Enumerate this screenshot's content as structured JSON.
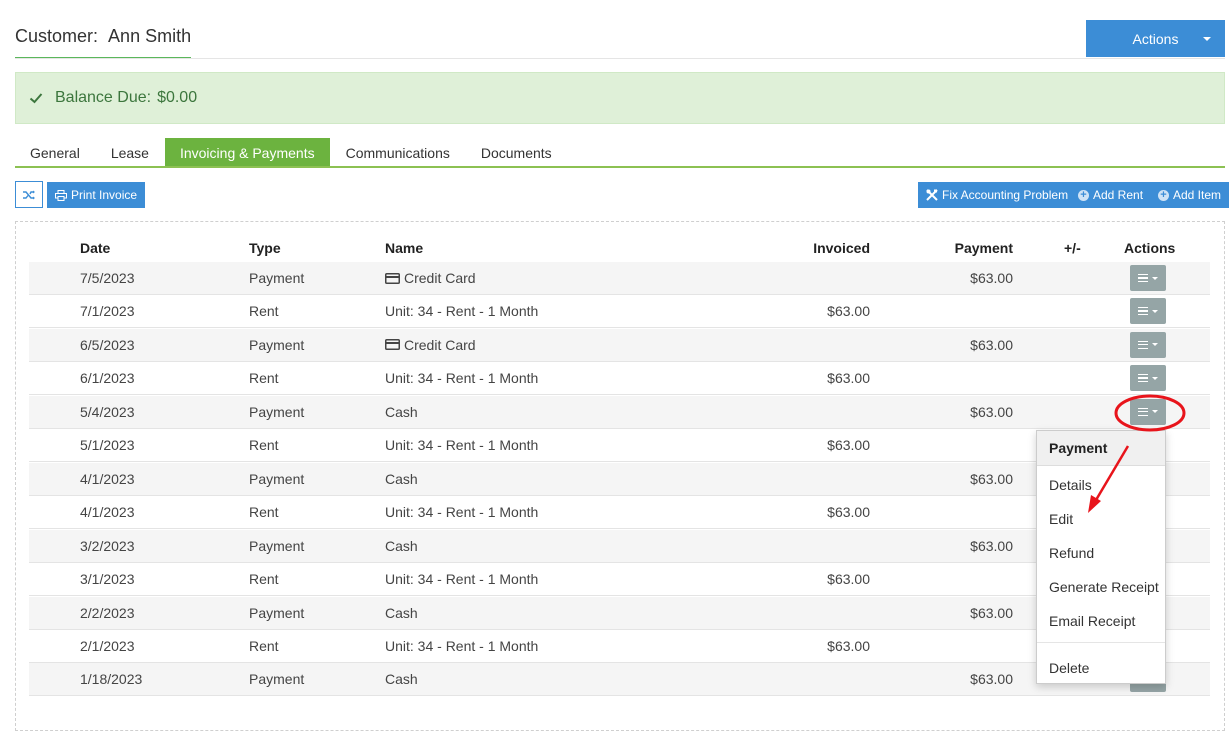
{
  "header": {
    "title_prefix": "Customer:",
    "customer_name": "Ann Smith",
    "actions_label": "Actions"
  },
  "balance": {
    "label": "Balance Due:",
    "amount": "$0.00"
  },
  "tabs": [
    {
      "label": "General"
    },
    {
      "label": "Lease"
    },
    {
      "label": "Invoicing & Payments",
      "active": true
    },
    {
      "label": "Communications"
    },
    {
      "label": "Documents"
    }
  ],
  "toolbar": {
    "print_invoice": "Print Invoice",
    "fix_accounting": "Fix Accounting Problem",
    "add_rent": "Add Rent",
    "add_item": "Add Item"
  },
  "table": {
    "headers": {
      "date": "Date",
      "type": "Type",
      "name": "Name",
      "invoiced": "Invoiced",
      "payment": "Payment",
      "plusminus": "+/-",
      "actions": "Actions"
    },
    "rows": [
      {
        "date": "7/5/2023",
        "type": "Payment",
        "name": "Credit Card",
        "card": true,
        "invoiced": "",
        "payment": "$63.00"
      },
      {
        "date": "7/1/2023",
        "type": "Rent",
        "name": "Unit: 34 - Rent - 1 Month",
        "invoiced": "$63.00",
        "payment": ""
      },
      {
        "date": "6/5/2023",
        "type": "Payment",
        "name": "Credit Card",
        "card": true,
        "invoiced": "",
        "payment": "$63.00"
      },
      {
        "date": "6/1/2023",
        "type": "Rent",
        "name": "Unit: 34 - Rent - 1 Month",
        "invoiced": "$63.00",
        "payment": ""
      },
      {
        "date": "5/4/2023",
        "type": "Payment",
        "name": "Cash",
        "invoiced": "",
        "payment": "$63.00"
      },
      {
        "date": "5/1/2023",
        "type": "Rent",
        "name": "Unit: 34 - Rent - 1 Month",
        "invoiced": "$63.00",
        "payment": ""
      },
      {
        "date": "4/1/2023",
        "type": "Payment",
        "name": "Cash",
        "invoiced": "",
        "payment": "$63.00"
      },
      {
        "date": "4/1/2023",
        "type": "Rent",
        "name": "Unit: 34 - Rent - 1 Month",
        "invoiced": "$63.00",
        "payment": ""
      },
      {
        "date": "3/2/2023",
        "type": "Payment",
        "name": "Cash",
        "invoiced": "",
        "payment": "$63.00"
      },
      {
        "date": "3/1/2023",
        "type": "Rent",
        "name": "Unit: 34 - Rent - 1 Month",
        "invoiced": "$63.00",
        "payment": ""
      },
      {
        "date": "2/2/2023",
        "type": "Payment",
        "name": "Cash",
        "invoiced": "",
        "payment": "$63.00"
      },
      {
        "date": "2/1/2023",
        "type": "Rent",
        "name": "Unit: 34 - Rent - 1 Month",
        "invoiced": "$63.00",
        "payment": ""
      },
      {
        "date": "1/18/2023",
        "type": "Payment",
        "name": "Cash",
        "invoiced": "",
        "payment": "$63.00"
      }
    ]
  },
  "dropdown": {
    "header": "Payment",
    "items": [
      "Details",
      "Edit",
      "Refund",
      "Generate Receipt",
      "Email Receipt"
    ],
    "delete": "Delete"
  },
  "colors": {
    "primary": "#3c8dd6",
    "tab_active": "#6cb33f",
    "balance_bg": "#dff0d8",
    "balance_text": "#3c763d",
    "row_action_button": "#95a5a6",
    "annotation": "#e8141b"
  }
}
